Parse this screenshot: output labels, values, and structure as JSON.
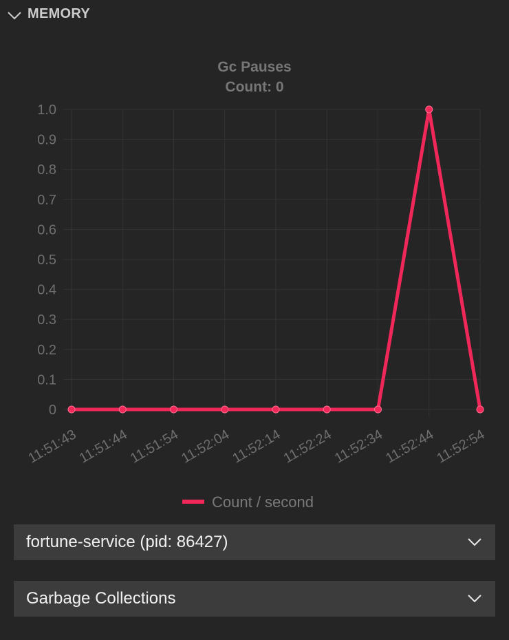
{
  "section": {
    "title": "MEMORY"
  },
  "colors": {
    "series": "#f0285a",
    "background": "#252526",
    "dropdown_bg": "#3c3c3c"
  },
  "chart_data": {
    "type": "line",
    "title": "Gc Pauses",
    "subtitle": "Count: 0",
    "x": [
      "11:51:43",
      "11:51:44",
      "11:51:54",
      "11:52:04",
      "11:52:14",
      "11:52:24",
      "11:52:34",
      "11:52:44",
      "11:52:54"
    ],
    "y_ticks": [
      "0",
      "0.1",
      "0.2",
      "0.3",
      "0.4",
      "0.5",
      "0.6",
      "0.7",
      "0.8",
      "0.9",
      "1.0"
    ],
    "ylim": [
      0,
      1
    ],
    "grid": true,
    "legend": "bottom",
    "series": [
      {
        "name": "Count / second",
        "values": [
          0,
          0,
          0,
          0,
          0,
          0,
          0,
          1,
          0
        ]
      }
    ]
  },
  "process_select": {
    "value": "fortune-service (pid: 86427)"
  },
  "metric_select": {
    "value": "Garbage Collections"
  }
}
